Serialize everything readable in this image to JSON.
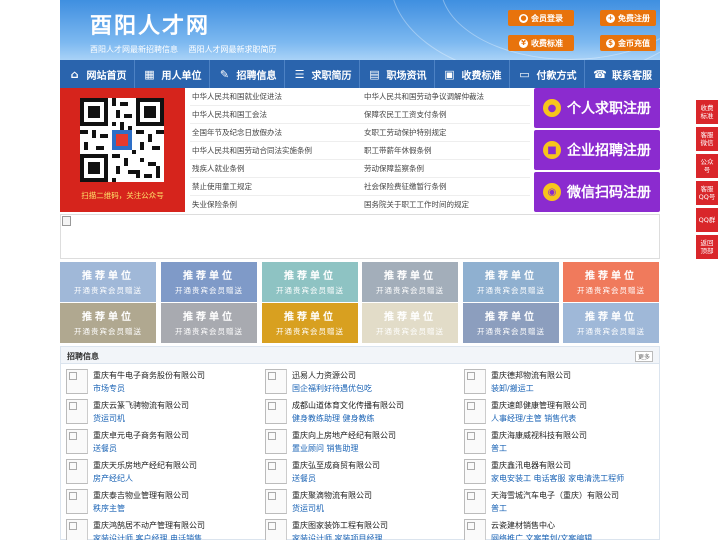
{
  "header": {
    "site_name": "酉阳人才网",
    "slogans": [
      "酉阳人才网最新招聘信息",
      "酉阳人才网最新求职简历"
    ],
    "buttons": [
      "会员登录",
      "免费注册",
      "收费标准",
      "金币充值"
    ]
  },
  "nav": [
    {
      "label": "网站首页",
      "icon": "home-icon"
    },
    {
      "label": "用人单位",
      "icon": "building-icon"
    },
    {
      "label": "招聘信息",
      "icon": "megaphone-icon"
    },
    {
      "label": "求职简历",
      "icon": "resume-icon"
    },
    {
      "label": "职场资讯",
      "icon": "news-icon"
    },
    {
      "label": "收费标准",
      "icon": "price-icon"
    },
    {
      "label": "付款方式",
      "icon": "payment-icon"
    },
    {
      "label": "联系客服",
      "icon": "phone-icon"
    }
  ],
  "qr": {
    "caption": "扫描二维码，关注公众号"
  },
  "laws": [
    "中华人民共和国就业促进法",
    "中华人民共和国劳动争议调解仲裁法",
    "中华人民共和国工会法",
    "保障农民工工资支付条例",
    "全国年节及纪念日放假办法",
    "女职工劳动保护特别规定",
    "中华人民共和国劳动合同法实施条例",
    "职工带薪年休假条例",
    "残疾人就业条例",
    "劳动保障监察条例",
    "禁止使用童工规定",
    "社会保险费征缴暂行条例",
    "失业保险条例",
    "国务院关于职工工作时间的规定"
  ],
  "register_buttons": [
    "个人求职注册",
    "企业招聘注册",
    "微信扫码注册"
  ],
  "recommend": {
    "title": "推荐单位",
    "subtitle": "开通贵宾会员赠送",
    "colors": [
      "#a0b8d8",
      "#7f9ac8",
      "#8ec3c3",
      "#a3aeba",
      "#8fb0d0",
      "#f07a5c",
      "#b0a890",
      "#a8aab0",
      "#d8a020",
      "#e2dcc8",
      "#8c9ebe",
      "#9fb8d8"
    ]
  },
  "jobs": {
    "title": "招聘信息",
    "more": "更多",
    "columns": [
      [
        {
          "company": "重庆有牛电子商务股份有限公司",
          "positions": "市场专员"
        },
        {
          "company": "重庆云篆飞骋物流有限公司",
          "positions": "货运司机"
        },
        {
          "company": "重庆卓元电子商务有限公司",
          "positions": "送餐员"
        },
        {
          "company": "重庆天乐房地产经纪有限公司",
          "positions": "房产经纪人"
        },
        {
          "company": "重庆泰吉物业管理有限公司",
          "positions": "秩序主管"
        },
        {
          "company": "重庆鸿鹄居不动产管理有限公司",
          "positions": "家装设计师 客户经理 电话销售"
        }
      ],
      [
        {
          "company": "迅易人力资源公司",
          "positions": "国企福利好待遇优包吃"
        },
        {
          "company": "成都山道体育文化传播有限公司",
          "positions": "健身教练助理 健身教练"
        },
        {
          "company": "重庆向上房地产经纪有限公司",
          "positions": "置业顾问 销售助理"
        },
        {
          "company": "重庆弘至成商贸有限公司",
          "positions": "送餐员"
        },
        {
          "company": "重庆聚滴物流有限公司",
          "positions": "货运司机"
        },
        {
          "company": "重庆图家装饰工程有限公司",
          "positions": "家装设计师 家装项目经理"
        }
      ],
      [
        {
          "company": "重庆德邦物流有限公司",
          "positions": "装卸/搬运工"
        },
        {
          "company": "重庆速郎健康管理有限公司",
          "positions": "人事经理/主管 销售代表"
        },
        {
          "company": "重庆海康威视科技有限公司",
          "positions": "普工"
        },
        {
          "company": "重庆鑫汛电器有限公司",
          "positions": "家电安装工 电话客服 家电清洗工程师"
        },
        {
          "company": "天海雪城汽车电子（重庆）有限公司",
          "positions": "普工"
        },
        {
          "company": "云瓷建材销售中心",
          "positions": "网络推广 文案策划/文案编辑"
        }
      ]
    ]
  },
  "sidebar": [
    "收费标准",
    "客服微信",
    "公众号",
    "客服QQ号",
    "QQ群",
    "返回顶部"
  ]
}
